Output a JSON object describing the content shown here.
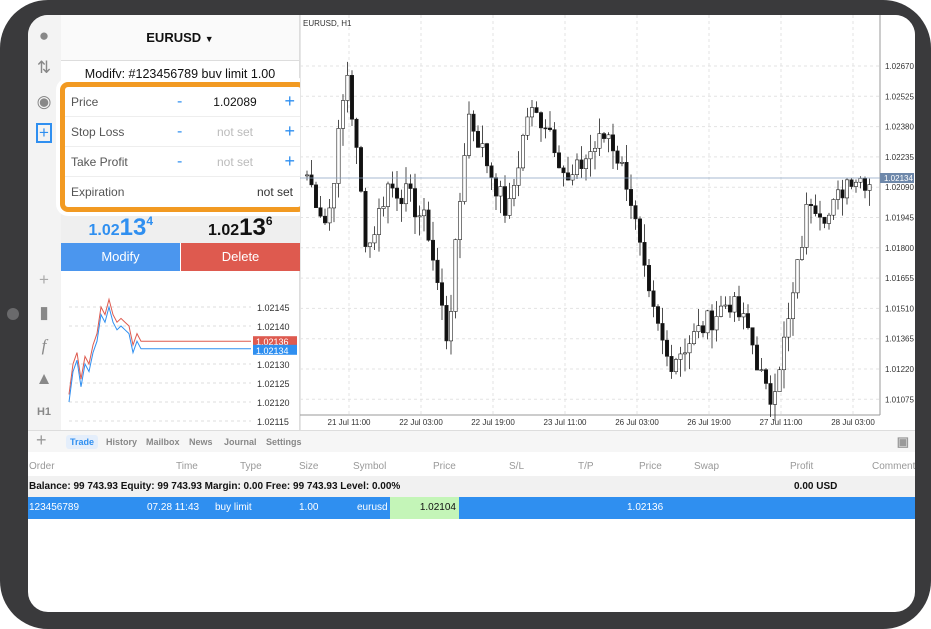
{
  "symbol_header": {
    "label": "EURUSD",
    "icon": "caret-down"
  },
  "modify_title": "Modify: #123456789 buy limit 1.00",
  "form": {
    "price": {
      "label": "Price",
      "value": "1.02089"
    },
    "stop_loss": {
      "label": "Stop Loss",
      "value": "not set"
    },
    "take_profit": {
      "label": "Take Profit",
      "value": "not set"
    },
    "expiration": {
      "label": "Expiration",
      "value": "not set"
    },
    "minus": "-",
    "plus": "+"
  },
  "quotes": {
    "bid_prefix": "1.02",
    "bid_big": "13",
    "bid_sup": "4",
    "ask_prefix": "1.02",
    "ask_big": "13",
    "ask_sup": "6",
    "bid_color": "#2f8ff0"
  },
  "buttons": {
    "modify": "Modify",
    "delete": "Delete",
    "modify_color": "#4b96ee",
    "delete_color": "#de5a4f"
  },
  "sidebar_icons": [
    "user-icon",
    "trade-arrows-icon",
    "chat-icon",
    "new-order-icon",
    "crosshair-icon",
    "candles-icon",
    "function-icon",
    "objects-icon"
  ],
  "timeframe": "H1",
  "mini_chart": {
    "ticks": [
      "1.02145",
      "1.02140",
      "1.02130",
      "1.02125",
      "1.02120",
      "1.02115"
    ],
    "ask_label": "1.02136",
    "bid_label": "1.02134",
    "ask_color": "#de5a4f",
    "bid_color": "#2f8ff0"
  },
  "main_chart": {
    "title": "EURUSD, H1",
    "y_ticks": [
      "1.02670",
      "1.02525",
      "1.02380",
      "1.02235",
      "1.02090",
      "1.01945",
      "1.01800",
      "1.01655",
      "1.01510",
      "1.01365",
      "1.01220",
      "1.01075"
    ],
    "current_price": "1.02134",
    "x_ticks": [
      "21 Jul 11:00",
      "22 Jul 03:00",
      "22 Jul 19:00",
      "23 Jul 11:00",
      "26 Jul 03:00",
      "26 Jul 19:00",
      "27 Jul 11:00",
      "28 Jul 03:00"
    ],
    "price_path": [
      1.0215,
      1.019,
      1.0265,
      1.0178,
      1.021,
      1.0205,
      1.019,
      1.0135,
      1.0245,
      1.022,
      1.0195,
      1.0245,
      1.024,
      1.021,
      1.0225,
      1.0235,
      1.021,
      1.0155,
      1.0125,
      1.0135,
      1.0145,
      1.0155,
      1.014,
      1.0105,
      1.0145,
      1.0205,
      1.0195,
      1.0215,
      1.0212
    ]
  },
  "bottom_tabs": [
    "Trade",
    "History",
    "Mailbox",
    "News",
    "Journal",
    "Settings"
  ],
  "columns": [
    "Order",
    "Time",
    "Type",
    "Size",
    "Symbol",
    "Price",
    "S/L",
    "T/P",
    "Price",
    "Swap",
    "Profit",
    "Comment"
  ],
  "balance_line": "Balance: 99 743.93 Equity: 99 743.93 Margin: 0.00 Free: 99 743.93 Level: 0.00%",
  "profit_total": "0.00  USD",
  "order": {
    "order": "123456789",
    "time": "07.28 11:43",
    "type": "buy limit",
    "size": "1.00",
    "symbol": "eurusd",
    "price": "1.02104",
    "current_price": "1.02136"
  }
}
